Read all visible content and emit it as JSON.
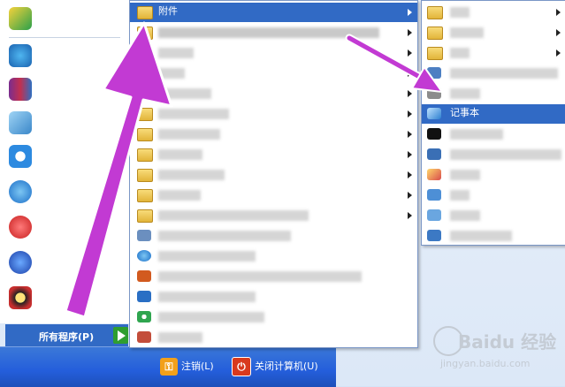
{
  "start_menu": {
    "pinned": [
      {
        "label": "",
        "icon": "app-icon-green"
      },
      {
        "label": "",
        "icon": "app-icon-blue"
      },
      {
        "label": "",
        "icon": "winrar-icon"
      },
      {
        "label": "",
        "icon": "notepad-icon"
      },
      {
        "label": "",
        "icon": "app-icon-s"
      },
      {
        "label": "",
        "icon": "ie-icon"
      },
      {
        "label": "",
        "icon": "app-icon-red"
      },
      {
        "label": "",
        "icon": "app-icon-b"
      },
      {
        "label": "",
        "icon": "qq-icon"
      }
    ],
    "all_programs_label": "所有程序(P)",
    "logoff_label": "注销(L)",
    "shutdown_label": "关闭计算机(U)"
  },
  "programs_menu": {
    "items": [
      {
        "label": "附件",
        "submenu": true,
        "selected": true,
        "icon": "folder-icon"
      },
      {
        "label": "",
        "submenu": true,
        "icon": "folder-icon"
      },
      {
        "label": "",
        "submenu": true,
        "icon": "folder-icon"
      },
      {
        "label": "",
        "submenu": true,
        "icon": "folder-icon"
      },
      {
        "label": "",
        "submenu": true,
        "icon": "folder-icon"
      },
      {
        "label": "",
        "submenu": true,
        "icon": "folder-icon"
      },
      {
        "label": "",
        "submenu": true,
        "icon": "folder-icon"
      },
      {
        "label": "",
        "submenu": true,
        "icon": "folder-icon"
      },
      {
        "label": "",
        "submenu": true,
        "icon": "folder-icon"
      },
      {
        "label": "",
        "submenu": true,
        "icon": "folder-icon"
      },
      {
        "label": "",
        "submenu": true,
        "icon": "folder-icon"
      },
      {
        "label": "",
        "submenu": false,
        "icon": "app-icon"
      },
      {
        "label": "",
        "submenu": false,
        "icon": "ie-icon"
      },
      {
        "label": "",
        "submenu": false,
        "icon": "powerpoint-icon"
      },
      {
        "label": "",
        "submenu": false,
        "icon": "outlook-icon"
      },
      {
        "label": "",
        "submenu": false,
        "icon": "media-player-icon"
      },
      {
        "label": "",
        "submenu": false,
        "icon": "app-icon"
      }
    ]
  },
  "accessories_menu": {
    "items": [
      {
        "label": "",
        "submenu": true,
        "icon": "folder-icon"
      },
      {
        "label": "",
        "submenu": true,
        "icon": "folder-icon"
      },
      {
        "label": "",
        "submenu": true,
        "icon": "folder-icon"
      },
      {
        "label": "",
        "submenu": false,
        "icon": "app-icon"
      },
      {
        "label": "",
        "submenu": false,
        "icon": "calculator-icon"
      },
      {
        "label": "记事本",
        "submenu": false,
        "selected": true,
        "icon": "notepad-icon"
      },
      {
        "label": "",
        "submenu": false,
        "icon": "cmd-icon"
      },
      {
        "label": "",
        "submenu": false,
        "icon": "app-icon"
      },
      {
        "label": "",
        "submenu": false,
        "icon": "paint-icon"
      },
      {
        "label": "",
        "submenu": false,
        "icon": "app-icon"
      },
      {
        "label": "",
        "submenu": false,
        "icon": "app-icon"
      },
      {
        "label": "",
        "submenu": false,
        "icon": "app-icon"
      }
    ]
  },
  "watermark": {
    "brand": "Baidu 经验",
    "url": "jingyan.baidu.com"
  },
  "colors": {
    "highlight": "#316ac5",
    "arrow": "#c23ad3",
    "bottom_bar": "#245edb"
  }
}
